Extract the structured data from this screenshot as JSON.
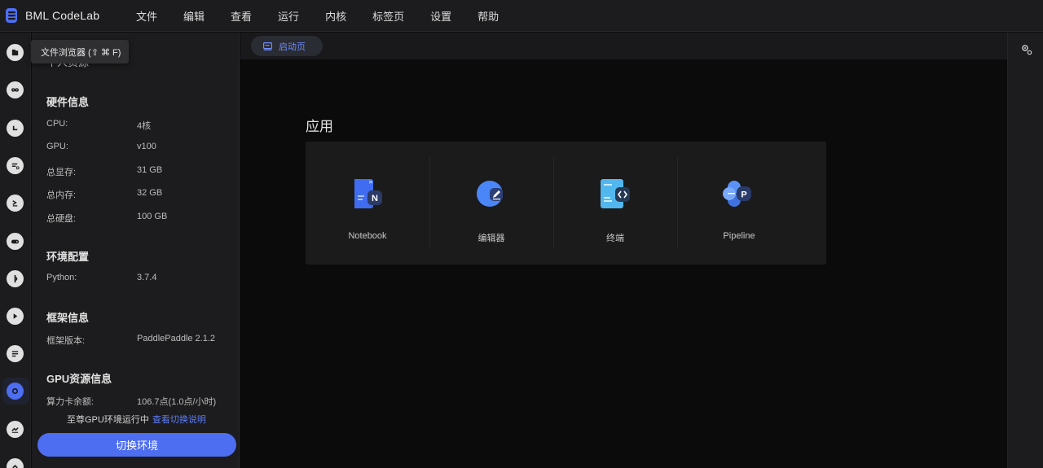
{
  "app": {
    "title": "BML CodeLab",
    "accent_color": "#4e6ef2"
  },
  "menu": [
    "文件",
    "编辑",
    "查看",
    "运行",
    "内核",
    "标签页",
    "设置",
    "帮助"
  ],
  "rail_icons": [
    "file-browser-icon",
    "infinity-icon",
    "clock-icon",
    "database-icon",
    "terminal-icon",
    "gamepad-icon",
    "git-icon",
    "play-icon",
    "document-icon",
    "resource-icon",
    "chart-icon",
    "chevron-up-icon"
  ],
  "tooltip": "文件浏览器 (⇧ ⌘ F)",
  "panel": {
    "partial_title": "个人资源",
    "hardware": {
      "title": "硬件信息",
      "rows": [
        {
          "key": "CPU:",
          "value": "4核"
        },
        {
          "key": "GPU:",
          "value": "v100"
        },
        {
          "key": "总显存:",
          "value": "31 GB"
        },
        {
          "key": "总内存:",
          "value": "32 GB"
        },
        {
          "key": "总硬盘:",
          "value": "100 GB"
        }
      ]
    },
    "env": {
      "title": "环境配置",
      "rows": [
        {
          "key": "Python:",
          "value": "3.7.4"
        }
      ]
    },
    "framework": {
      "title": "框架信息",
      "rows": [
        {
          "key": "框架版本:",
          "value": "PaddlePaddle 2.1.2"
        }
      ]
    },
    "gpu": {
      "title": "GPU资源信息",
      "rows": [
        {
          "key": "算力卡余额:",
          "value": "106.7点(1.0点/小时)"
        }
      ]
    },
    "note": "至尊GPU环境运行中",
    "note_link": "查看切换说明",
    "switch_button": "切换环境"
  },
  "main": {
    "tab_label": "启动页",
    "section_heading": "应用",
    "apps": [
      {
        "label": "Notebook",
        "icon": "notebook-icon"
      },
      {
        "label": "编辑器",
        "icon": "editor-icon"
      },
      {
        "label": "终端",
        "icon": "terminal-app-icon"
      },
      {
        "label": "Pipeline",
        "icon": "pipeline-icon"
      }
    ]
  }
}
